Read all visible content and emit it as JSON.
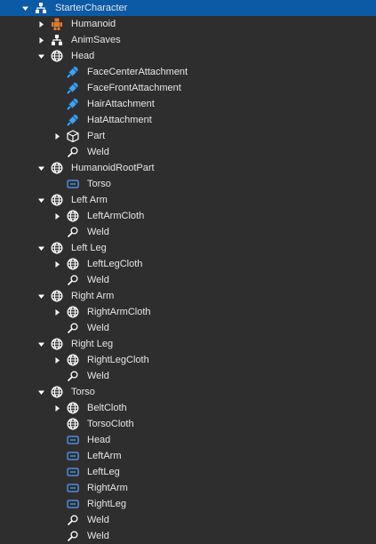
{
  "explorer": {
    "rows": [
      {
        "label": "StarterCharacter",
        "icon": "model-icon",
        "depth": 0,
        "expand": "expanded",
        "selected": true
      },
      {
        "label": "Humanoid",
        "icon": "humanoid-icon",
        "depth": 1,
        "expand": "collapsed"
      },
      {
        "label": "AnimSaves",
        "icon": "model-icon",
        "depth": 1,
        "expand": "collapsed"
      },
      {
        "label": "Head",
        "icon": "meshpart-icon",
        "depth": 1,
        "expand": "expanded"
      },
      {
        "label": "FaceCenterAttachment",
        "icon": "attachment-icon",
        "depth": 2,
        "expand": "none"
      },
      {
        "label": "FaceFrontAttachment",
        "icon": "attachment-icon",
        "depth": 2,
        "expand": "none"
      },
      {
        "label": "HairAttachment",
        "icon": "attachment-icon",
        "depth": 2,
        "expand": "none"
      },
      {
        "label": "HatAttachment",
        "icon": "attachment-icon",
        "depth": 2,
        "expand": "none"
      },
      {
        "label": "Part",
        "icon": "part-icon",
        "depth": 2,
        "expand": "collapsed"
      },
      {
        "label": "Weld",
        "icon": "weld-icon",
        "depth": 2,
        "expand": "none"
      },
      {
        "label": "HumanoidRootPart",
        "icon": "meshpart-icon",
        "depth": 1,
        "expand": "expanded"
      },
      {
        "label": "Torso",
        "icon": "motor-icon",
        "depth": 2,
        "expand": "none"
      },
      {
        "label": "Left Arm",
        "icon": "meshpart-icon",
        "depth": 1,
        "expand": "expanded"
      },
      {
        "label": "LeftArmCloth",
        "icon": "meshpart-icon",
        "depth": 2,
        "expand": "collapsed"
      },
      {
        "label": "Weld",
        "icon": "weld-icon",
        "depth": 2,
        "expand": "none"
      },
      {
        "label": "Left Leg",
        "icon": "meshpart-icon",
        "depth": 1,
        "expand": "expanded"
      },
      {
        "label": "LeftLegCloth",
        "icon": "meshpart-icon",
        "depth": 2,
        "expand": "collapsed"
      },
      {
        "label": "Weld",
        "icon": "weld-icon",
        "depth": 2,
        "expand": "none"
      },
      {
        "label": "Right Arm",
        "icon": "meshpart-icon",
        "depth": 1,
        "expand": "expanded"
      },
      {
        "label": "RightArmCloth",
        "icon": "meshpart-icon",
        "depth": 2,
        "expand": "collapsed"
      },
      {
        "label": "Weld",
        "icon": "weld-icon",
        "depth": 2,
        "expand": "none"
      },
      {
        "label": "Right Leg",
        "icon": "meshpart-icon",
        "depth": 1,
        "expand": "expanded"
      },
      {
        "label": "RightLegCloth",
        "icon": "meshpart-icon",
        "depth": 2,
        "expand": "collapsed"
      },
      {
        "label": "Weld",
        "icon": "weld-icon",
        "depth": 2,
        "expand": "none"
      },
      {
        "label": "Torso",
        "icon": "meshpart-icon",
        "depth": 1,
        "expand": "expanded"
      },
      {
        "label": "BeltCloth",
        "icon": "meshpart-icon",
        "depth": 2,
        "expand": "collapsed"
      },
      {
        "label": "TorsoCloth",
        "icon": "meshpart-icon",
        "depth": 2,
        "expand": "none"
      },
      {
        "label": "Head",
        "icon": "motor-icon",
        "depth": 2,
        "expand": "none"
      },
      {
        "label": "LeftArm",
        "icon": "motor-icon",
        "depth": 2,
        "expand": "none"
      },
      {
        "label": "LeftLeg",
        "icon": "motor-icon",
        "depth": 2,
        "expand": "none"
      },
      {
        "label": "RightArm",
        "icon": "motor-icon",
        "depth": 2,
        "expand": "none"
      },
      {
        "label": "RightLeg",
        "icon": "motor-icon",
        "depth": 2,
        "expand": "none"
      },
      {
        "label": "Weld",
        "icon": "weld-icon",
        "depth": 2,
        "expand": "none"
      },
      {
        "label": "Weld",
        "icon": "weld-icon",
        "depth": 2,
        "expand": "none"
      }
    ]
  },
  "colors": {
    "background": "#2e2e2e",
    "selected": "#0b5aa6",
    "text": "#e6e6e6",
    "attachment": "#3aa0ff",
    "motor": "#4aa3ff",
    "humanoid": "#e07b2d"
  }
}
